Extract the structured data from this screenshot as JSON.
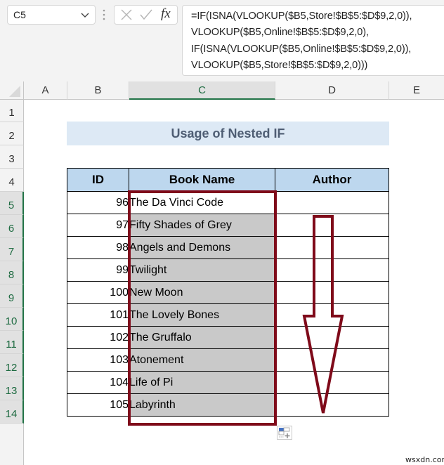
{
  "formula_bar": {
    "name_box": "C5",
    "formula_lines": [
      "=IF(ISNA(VLOOKUP($B5,Store!$B$5:$D$9,2,0)),",
      "VLOOKUP($B5,Online!$B$5:$D$9,2,0),",
      "IF(ISNA(VLOOKUP($B5,Online!$B$5:$D$9,2,0)),",
      "VLOOKUP($B5,Store!$B$5:$D$9,2,0)))"
    ],
    "fx_label": "fx"
  },
  "columns": [
    "A",
    "B",
    "C",
    "D",
    "E"
  ],
  "selected_column": "C",
  "rows": [
    "1",
    "2",
    "3",
    "4",
    "5",
    "6",
    "7",
    "8",
    "9",
    "10",
    "11",
    "12",
    "13",
    "14"
  ],
  "selected_rows": [
    "5",
    "6",
    "7",
    "8",
    "9",
    "10",
    "11",
    "12",
    "13",
    "14"
  ],
  "sheet": {
    "title": "Usage of Nested IF",
    "headers": {
      "id": "ID",
      "book": "Book Name",
      "author": "Author"
    },
    "records": [
      {
        "id": "96",
        "book": "The Da Vinci Code",
        "author": ""
      },
      {
        "id": "97",
        "book": "Fifty Shades of Grey",
        "author": ""
      },
      {
        "id": "98",
        "book": "Angels and Demons",
        "author": ""
      },
      {
        "id": "99",
        "book": "Twilight",
        "author": ""
      },
      {
        "id": "100",
        "book": "New Moon",
        "author": ""
      },
      {
        "id": "101",
        "book": "The Lovely Bones",
        "author": ""
      },
      {
        "id": "102",
        "book": "The Gruffalo",
        "author": ""
      },
      {
        "id": "103",
        "book": "Atonement",
        "author": ""
      },
      {
        "id": "104",
        "book": "Life of Pi",
        "author": ""
      },
      {
        "id": "105",
        "book": "Labyrinth",
        "author": ""
      }
    ]
  },
  "colors": {
    "highlight": "#7f0a1a",
    "header_fill": "#bdd7ee",
    "title_fill": "#dde9f5",
    "selection_fill": "#c9c9c9",
    "excel_green": "#217346"
  },
  "watermark": "wsxdn.com"
}
